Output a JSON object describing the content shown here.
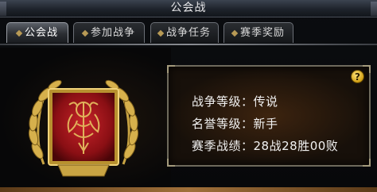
{
  "window": {
    "title": "公会战"
  },
  "tabs": [
    {
      "label": "公会战"
    },
    {
      "label": "参加战争"
    },
    {
      "label": "战争任务"
    },
    {
      "label": "赛季奖励"
    }
  ],
  "info": {
    "help_label": "?",
    "rows": [
      {
        "label": "战争等级：",
        "value": "传说"
      },
      {
        "label": "名誉等级：",
        "value": "新手"
      },
      {
        "label": "赛季战绩：",
        "value": "28战28胜00败"
      }
    ]
  },
  "icons": {
    "emblem": "guild-emblem-icon",
    "laurel": "laurel-wreath-icon",
    "help": "help-icon"
  },
  "colors": {
    "emblem_red": "#a8151b",
    "emblem_gold": "#d6b04c",
    "text": "#f2f2f2"
  }
}
